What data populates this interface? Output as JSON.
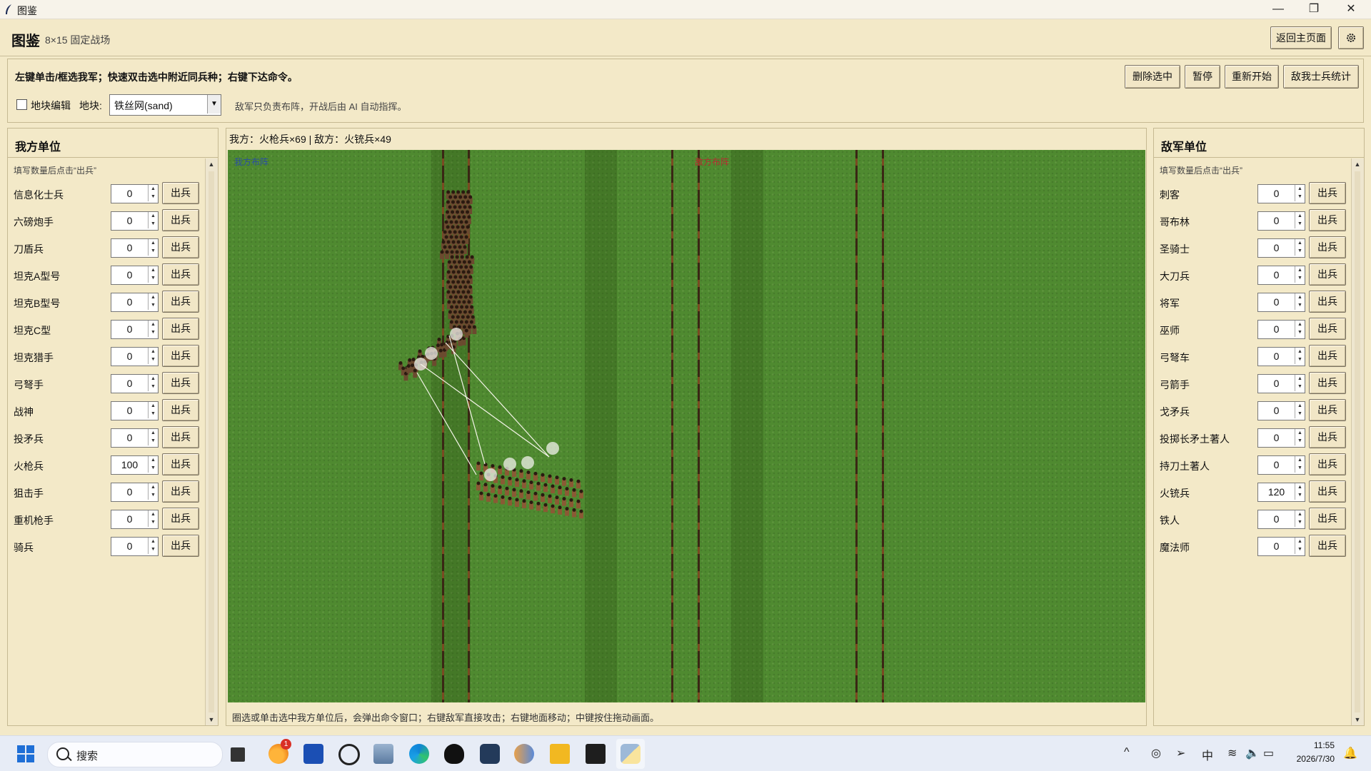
{
  "window": {
    "title": "图鉴",
    "minimize": "—",
    "maximize": "❐",
    "close": "✕"
  },
  "header": {
    "title": "图鉴",
    "subtitle": "8×15 固定战场",
    "home_button": "返回主页面",
    "settings_icon": "gear-icon"
  },
  "controls": {
    "hint": "左键单击/框选我军；快速双击选中附近同兵种；右键下达命令。",
    "buttons": [
      "删除选中",
      "暂停",
      "重新开始",
      "敌我士兵统计"
    ],
    "tile_edit_label": "地块编辑",
    "tile_edit_checked": false,
    "terrain_label": "地块:",
    "terrain_value": "铁丝网(sand)",
    "enemy_note": "敌军只负责布阵，开战后由 AI 自动指挥。"
  },
  "left_panel": {
    "title": "我方单位",
    "hint": "填写数量后点击“出兵”",
    "deploy_label": "出兵",
    "units": [
      {
        "name": "信息化士兵",
        "count": "0"
      },
      {
        "name": "六磅炮手",
        "count": "0"
      },
      {
        "name": "刀盾兵",
        "count": "0"
      },
      {
        "name": "坦克A型号",
        "count": "0"
      },
      {
        "name": "坦克B型号",
        "count": "0"
      },
      {
        "name": "坦克C型",
        "count": "0"
      },
      {
        "name": "坦克猎手",
        "count": "0"
      },
      {
        "name": "弓弩手",
        "count": "0"
      },
      {
        "name": "战神",
        "count": "0"
      },
      {
        "name": "投矛兵",
        "count": "0"
      },
      {
        "name": "火枪兵",
        "count": "100"
      },
      {
        "name": "狙击手",
        "count": "0"
      },
      {
        "name": "重机枪手",
        "count": "0"
      },
      {
        "name": "骑兵",
        "count": "0"
      }
    ]
  },
  "right_panel": {
    "title": "敌军单位",
    "hint": "填写数量后点击“出兵”",
    "deploy_label": "出兵",
    "units": [
      {
        "name": "刺客",
        "count": "0"
      },
      {
        "name": "哥布林",
        "count": "0"
      },
      {
        "name": "圣骑士",
        "count": "0"
      },
      {
        "name": "大刀兵",
        "count": "0"
      },
      {
        "name": "将军",
        "count": "0"
      },
      {
        "name": "巫师",
        "count": "0"
      },
      {
        "name": "弓弩车",
        "count": "0"
      },
      {
        "name": "弓箭手",
        "count": "0"
      },
      {
        "name": "戈矛兵",
        "count": "0"
      },
      {
        "name": "投掷长矛土著人",
        "count": "0"
      },
      {
        "name": "持刀土著人",
        "count": "0"
      },
      {
        "name": "火铳兵",
        "count": "120"
      },
      {
        "name": "铁人",
        "count": "0"
      },
      {
        "name": "魔法师",
        "count": "0"
      }
    ]
  },
  "battlefield": {
    "status": "我方：火枪兵×69 | 敌方：火铳兵×49",
    "our_deploy_label": "我方布阵",
    "enemy_deploy_label": "敌方布阵",
    "bottom_hint": "圈选或单击选中我方单位后，会弹出命令窗口；右键敌军直接攻击；右键地面移动；中键按住拖动画面。",
    "colors": {
      "grass": "#4f8a30",
      "ours": "#6b4a2f",
      "enemy": "#8a5a35"
    }
  },
  "taskbar": {
    "search_placeholder": "搜索",
    "notification_badge": "1",
    "icons": [
      "windows-start-icon",
      "search-icon",
      "file-explorer-icon",
      "weather-icon",
      "store-icon",
      "chatgpt-icon",
      "monitor-icon",
      "edge-icon",
      "qq-icon",
      "cat-icon",
      "people-icon",
      "folder-icon",
      "terminal-icon",
      "python-icon"
    ],
    "tray": {
      "chevron": "^",
      "ime": "中",
      "time": "11:55",
      "date": "2026/7/30"
    }
  }
}
